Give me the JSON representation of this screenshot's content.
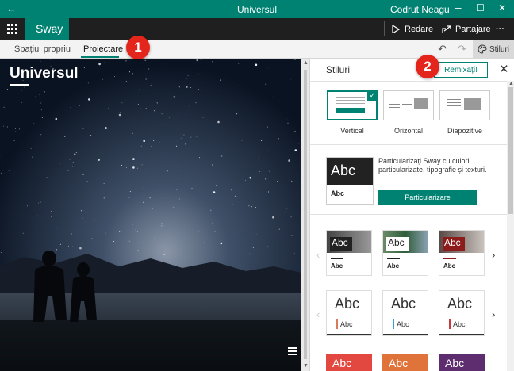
{
  "titlebar": {
    "title": "Universul",
    "user": "Codrut Neagu",
    "back_icon": "←",
    "minimize_icon": "─",
    "maximize_icon": "☐",
    "close_icon": "✕"
  },
  "appbar": {
    "brand": "Sway",
    "play_label": "Redare",
    "share_label": "Partajare",
    "more_icon": "···"
  },
  "tabs": [
    {
      "label": "Spațiul propriu"
    },
    {
      "label": "Proiectare"
    }
  ],
  "toolbar": {
    "styles_label": "Stiluri",
    "undo_icon": "↶",
    "redo_icon": "↷"
  },
  "canvas": {
    "title": "Universul"
  },
  "badges": [
    "1",
    "2"
  ],
  "panel": {
    "title": "Stiluri",
    "remix_label": "Remixați!",
    "close_icon": "✕",
    "layouts": [
      {
        "label": "Vertical",
        "selected": true
      },
      {
        "label": "Orizontal",
        "selected": false
      },
      {
        "label": "Diapozitive",
        "selected": false
      }
    ],
    "customize": {
      "card_big": "Abc",
      "card_small": "Abc",
      "text": "Particularizați Sway cu culori particularizate, tipografie și texturi.",
      "button": "Particularizare"
    },
    "theme_row1": [
      {
        "big": "Abc",
        "small": "Abc",
        "color": "#222222"
      },
      {
        "big": "Abc",
        "small": "Abc",
        "color": "#222222"
      },
      {
        "big": "Abc",
        "small": "Abc",
        "color": "#8c1b1b"
      }
    ],
    "theme_row2": [
      {
        "big": "Abc",
        "small": "Abc",
        "accent": "#d77b5c"
      },
      {
        "big": "Abc",
        "small": "Abc",
        "accent": "#3aa4c8"
      },
      {
        "big": "Abc",
        "small": "Abc",
        "accent": "#cc3b3b"
      }
    ],
    "theme_row3": [
      {
        "big": "Abc",
        "color": "#e2483f"
      },
      {
        "big": "Abc",
        "color": "#e0733a"
      },
      {
        "big": "Abc",
        "color": "#5d2d6f"
      }
    ],
    "arrow_left": "‹",
    "arrow_right": "›"
  },
  "colors": {
    "accent": "#008272",
    "badge": "#e4251b"
  }
}
